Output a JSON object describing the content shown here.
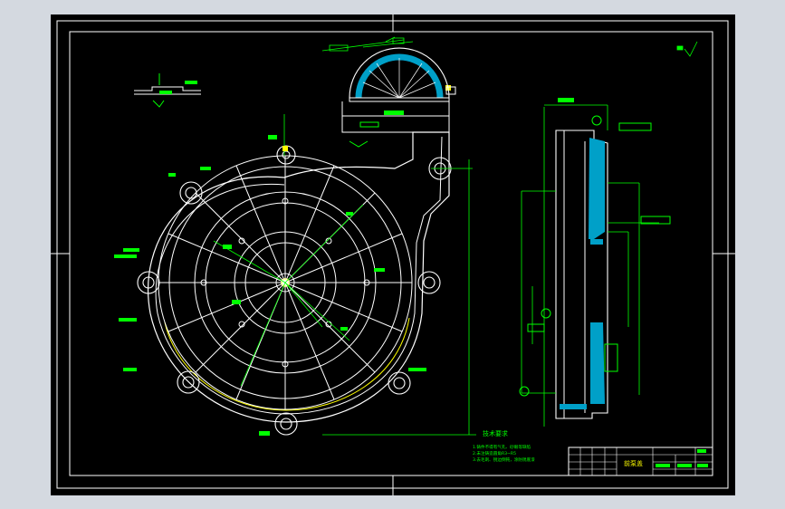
{
  "drawing": {
    "notes_title": "技术要求",
    "notes": [
      "1.铸件不得有气孔、砂眼等缺陷",
      "2.未注铸造圆角R3~R5",
      "3.去毛刺、锐边倒钝，涂防锈底漆"
    ],
    "title_block": {
      "part_name": "前泵盖"
    }
  },
  "colors": {
    "background": "#000000",
    "frame": "#ffffff",
    "geometry": "#ffffff",
    "dimension": "#00ff00",
    "section_fill": "#00a0c8",
    "highlight": "#ffff00",
    "viewport": "#d4d9e0"
  }
}
